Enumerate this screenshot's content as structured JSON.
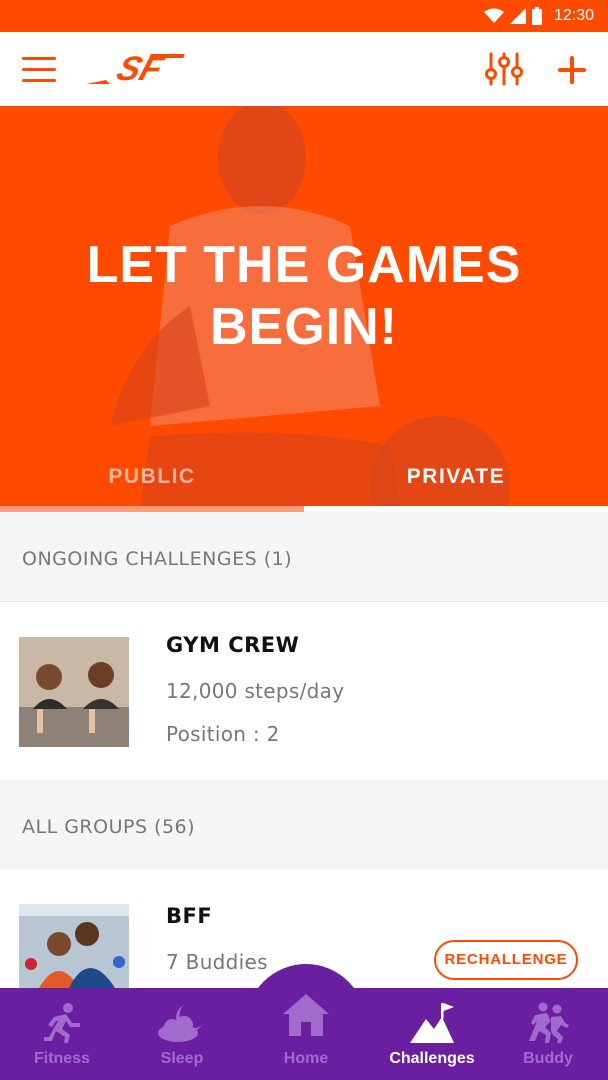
{
  "status_bar": {
    "time": "12:30"
  },
  "app_bar": {
    "logo_text": "SF"
  },
  "hero": {
    "title": "LET THE GAMES\nBEGIN!",
    "tabs": [
      {
        "label": "PUBLIC",
        "selected": false
      },
      {
        "label": "PRIVATE",
        "selected": true
      }
    ]
  },
  "ongoing": {
    "header": "ONGOING CHALLENGES (1)",
    "items": [
      {
        "name": "GYM CREW",
        "line1": "12,000 steps/day",
        "line2": "Position : 2"
      }
    ]
  },
  "groups": {
    "header": "ALL GROUPS (56)",
    "items": [
      {
        "name": "BFF",
        "line1": "7 Buddies",
        "action": "RECHALLENGE"
      }
    ]
  },
  "bottom_nav": {
    "items": [
      {
        "label": "Fitness",
        "icon": "runner-icon"
      },
      {
        "label": "Sleep",
        "icon": "moon-cloud-icon"
      },
      {
        "label": "Home",
        "icon": "home-icon"
      },
      {
        "label": "Challenges",
        "icon": "mountain-flag-icon",
        "active": true
      },
      {
        "label": "Buddy",
        "icon": "buddy-runners-icon"
      }
    ]
  },
  "colors": {
    "accent": "#ff4a00",
    "nav": "#6a1fa0",
    "nav_inactive": "#a06bcc"
  }
}
